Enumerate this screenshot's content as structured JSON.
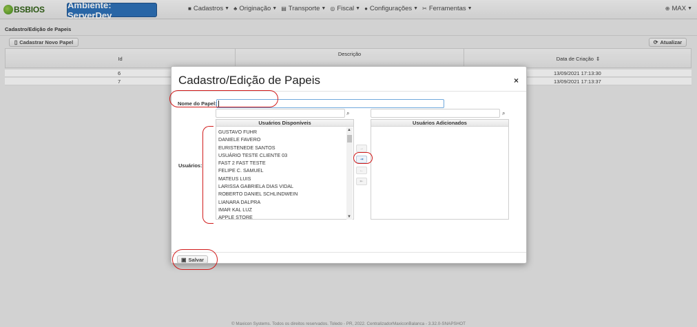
{
  "brand": {
    "logo_text": "BSBIOS",
    "logo_icon": "leaf-logo-icon"
  },
  "environment": {
    "label": "Ambiente: ServerDev",
    "color": "#2a6fb8"
  },
  "menu": [
    {
      "label": "Cadastros",
      "icon": "square-icon"
    },
    {
      "label": "Originação",
      "icon": "plant-icon"
    },
    {
      "label": "Transporte",
      "icon": "clipboard-icon"
    },
    {
      "label": "Fiscal",
      "icon": "coin-icon"
    },
    {
      "label": "Configurações",
      "icon": "gear-icon"
    },
    {
      "label": "Ferramentas",
      "icon": "tools-icon"
    }
  ],
  "user": {
    "name": "MAX",
    "icon": "user-icon"
  },
  "page": {
    "title": "Cadastro/Edição de Papeis",
    "new_button": "Cadastrar Novo Papel",
    "refresh_button": "Atualizar",
    "columns": {
      "id": "Id",
      "descricao": "Descrição",
      "data_criacao": "Data de Criação"
    },
    "sort_icon": "⇕",
    "rows": [
      {
        "id": "6",
        "data_criacao": "13/09/2021 17:13:30"
      },
      {
        "id": "7",
        "data_criacao": "13/09/2021 17:13:37"
      }
    ]
  },
  "modal": {
    "title": "Cadastro/Edição de Papeis",
    "close": "×",
    "nome_label": "Nome do Papel:",
    "nome_value": "",
    "usuarios_label": "Usuários:",
    "disponiveis_header": "Usuários Disponíveis",
    "adicionados_header": "Usuários Adicionados",
    "disponiveis": [
      "GUSTAVO FUHR",
      "DANIELE FAVERO",
      "EURISTENEDE SANTOS",
      "USUÁRIO TESTE CLIENTE 03",
      "FAST 2 FAST TESTE",
      "FELIPE C. SAMUEL",
      "MATEUS LUIS",
      "LARISSA GABRIELA DIAS VIDAL",
      "ROBERTO DANIEL SCHLINDWEIN",
      "LIANARA DALPRA",
      "IMAR KAL LUZ",
      "APPLE STORE"
    ],
    "move_buttons": {
      "add_one": "→",
      "add_all": "⇥",
      "remove_one": "←",
      "remove_all": "⇤"
    },
    "save_button": "Salvar"
  },
  "footer": {
    "text": "© Maxicon Systems. Todos os direitos reservados. Toledo - PR, 2022.    CentralizadorMaxiconBalanca - 3.32.0-SNAPSHOT"
  }
}
